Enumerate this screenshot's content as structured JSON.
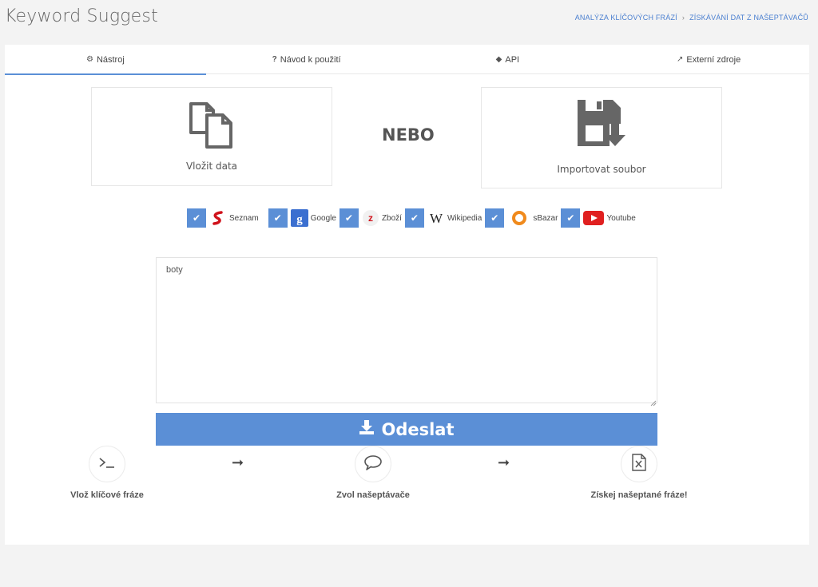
{
  "header": {
    "title": "Keyword Suggest",
    "breadcrumb": [
      "ANALÝZA KLÍČOVÝCH FRÁZÍ",
      "ZÍSKÁVÁNÍ DAT Z NAŠEPTÁVAČŮ"
    ],
    "breadcrumb_sep": "›"
  },
  "tabs": [
    {
      "label": "Nástroj",
      "icon": "gears-icon",
      "glyph": "⚙",
      "active": true
    },
    {
      "label": "Návod k použití",
      "icon": "question-icon",
      "glyph": "?"
    },
    {
      "label": "API",
      "icon": "cube-icon",
      "glyph": "◆"
    },
    {
      "label": "Externí zdroje",
      "icon": "external-link-icon",
      "glyph": "↗"
    }
  ],
  "input_options": {
    "paste_label": "Vložit data",
    "or_label": "NEBO",
    "import_label": "Importovat soubor"
  },
  "sources": [
    {
      "label": "Seznam",
      "checked": true,
      "icon": "seznam-icon"
    },
    {
      "label": "Google",
      "checked": true,
      "icon": "google-icon"
    },
    {
      "label": "Zboží",
      "checked": true,
      "icon": "zbozi-icon"
    },
    {
      "label": "Wikipedia",
      "checked": true,
      "icon": "wikipedia-icon"
    },
    {
      "label": "sBazar",
      "checked": true,
      "icon": "sbazar-icon"
    },
    {
      "label": "Youtube",
      "checked": true,
      "icon": "youtube-icon"
    }
  ],
  "keywords_input": {
    "value": "boty"
  },
  "submit": {
    "label": "Odeslat"
  },
  "steps": [
    {
      "label": "Vlož klíčové fráze",
      "icon": "terminal-icon"
    },
    {
      "label": "Zvol našeptávače",
      "icon": "speech-bubble-icon"
    },
    {
      "label": "Získej našeptané fráze!",
      "icon": "excel-file-icon"
    }
  ],
  "colors": {
    "accent": "#5b8fd6",
    "link": "#4a7fd0",
    "background": "#f3f3f3"
  }
}
